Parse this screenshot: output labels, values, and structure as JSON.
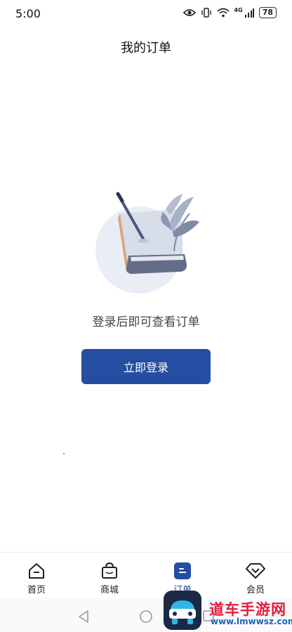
{
  "status_bar": {
    "time": "5:00",
    "battery": "78",
    "network": "4G"
  },
  "header": {
    "title": "我的订单"
  },
  "empty_state": {
    "message": "登录后即可查看订单",
    "login_button": "立即登录"
  },
  "tab_bar": {
    "items": [
      {
        "label": "首页",
        "icon": "home-icon",
        "active": false
      },
      {
        "label": "商城",
        "icon": "shopping-bag-icon",
        "active": false
      },
      {
        "label": "订单",
        "icon": "order-icon",
        "active": true
      },
      {
        "label": "会员",
        "icon": "member-diamond-icon",
        "active": false
      }
    ]
  },
  "watermark": {
    "text": "道车手游网",
    "url": "www.lmwwsz.com"
  },
  "colors": {
    "accent": "#254da1",
    "watermark_red": "#e21d3b",
    "watermark_blue": "#1e63c6"
  }
}
